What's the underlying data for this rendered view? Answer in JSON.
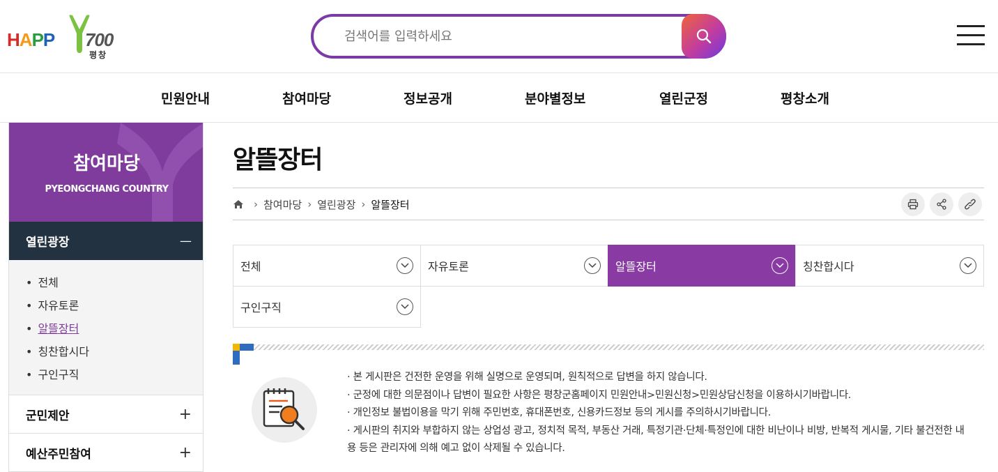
{
  "header": {
    "logo": {
      "text_h": "HAPP",
      "text_num": "700",
      "sub": "평창"
    },
    "search": {
      "placeholder": "검색어를 입력하세요"
    }
  },
  "gnb": [
    "민원안내",
    "참여마당",
    "정보공개",
    "분야별정보",
    "열린군정",
    "평창소개"
  ],
  "sidebar": {
    "title": "참여마당",
    "subtitle": "PYEONGCHANG COUNTRY",
    "active_menu": {
      "label": "열린광장",
      "toggle": "—"
    },
    "items": [
      "전체",
      "자유토론",
      "알뜰장터",
      "칭찬합시다",
      "구인구직"
    ],
    "current_item": "알뜰장터",
    "menus": [
      {
        "label": "군민제안",
        "toggle": "+"
      },
      {
        "label": "예산주민참여",
        "toggle": "+"
      }
    ]
  },
  "page": {
    "title": "알뜰장터",
    "breadcrumb": [
      "참여마당",
      "열린광장",
      "알뜰장터"
    ],
    "tools": [
      "print-icon",
      "share-icon",
      "link-icon"
    ]
  },
  "tabs": [
    {
      "label": "전체",
      "active": false
    },
    {
      "label": "자유토론",
      "active": false
    },
    {
      "label": "알뜰장터",
      "active": true
    },
    {
      "label": "칭찬합시다",
      "active": false
    },
    {
      "label": "구인구직",
      "active": false
    }
  ],
  "notice": {
    "lines": [
      "· 본 게시판은 건전한 운영을 위해 실명으로 운영되며, 원칙적으로 답변을 하지 않습니다.",
      "· 군정에 대한 의문점이나 답변이 필요한 사항은 평창군홈페이지 민원안내>민원신청>민원상담신청을 이용하시기바랍니다.",
      "· 개인정보 불법이용을 막기 위해 주민번호, 휴대폰번호, 신용카드정보 등의 게시를 주의하시기바랍니다.",
      "· 게시판의 취지와 부합하지 않는 상업성 광고, 정치적 목적, 부동산 거래, 특정기관·단체·특정인에 대한 비난이나 비방, 반복적 게시물, 기타 불건전한 내용 등은 관리자에 의해 예고 없이 삭제될 수 있습니다."
    ]
  },
  "colors": {
    "accent": "#8a3ba3",
    "sidebar_dark": "#233240",
    "search_border": "#7b3aa5"
  }
}
